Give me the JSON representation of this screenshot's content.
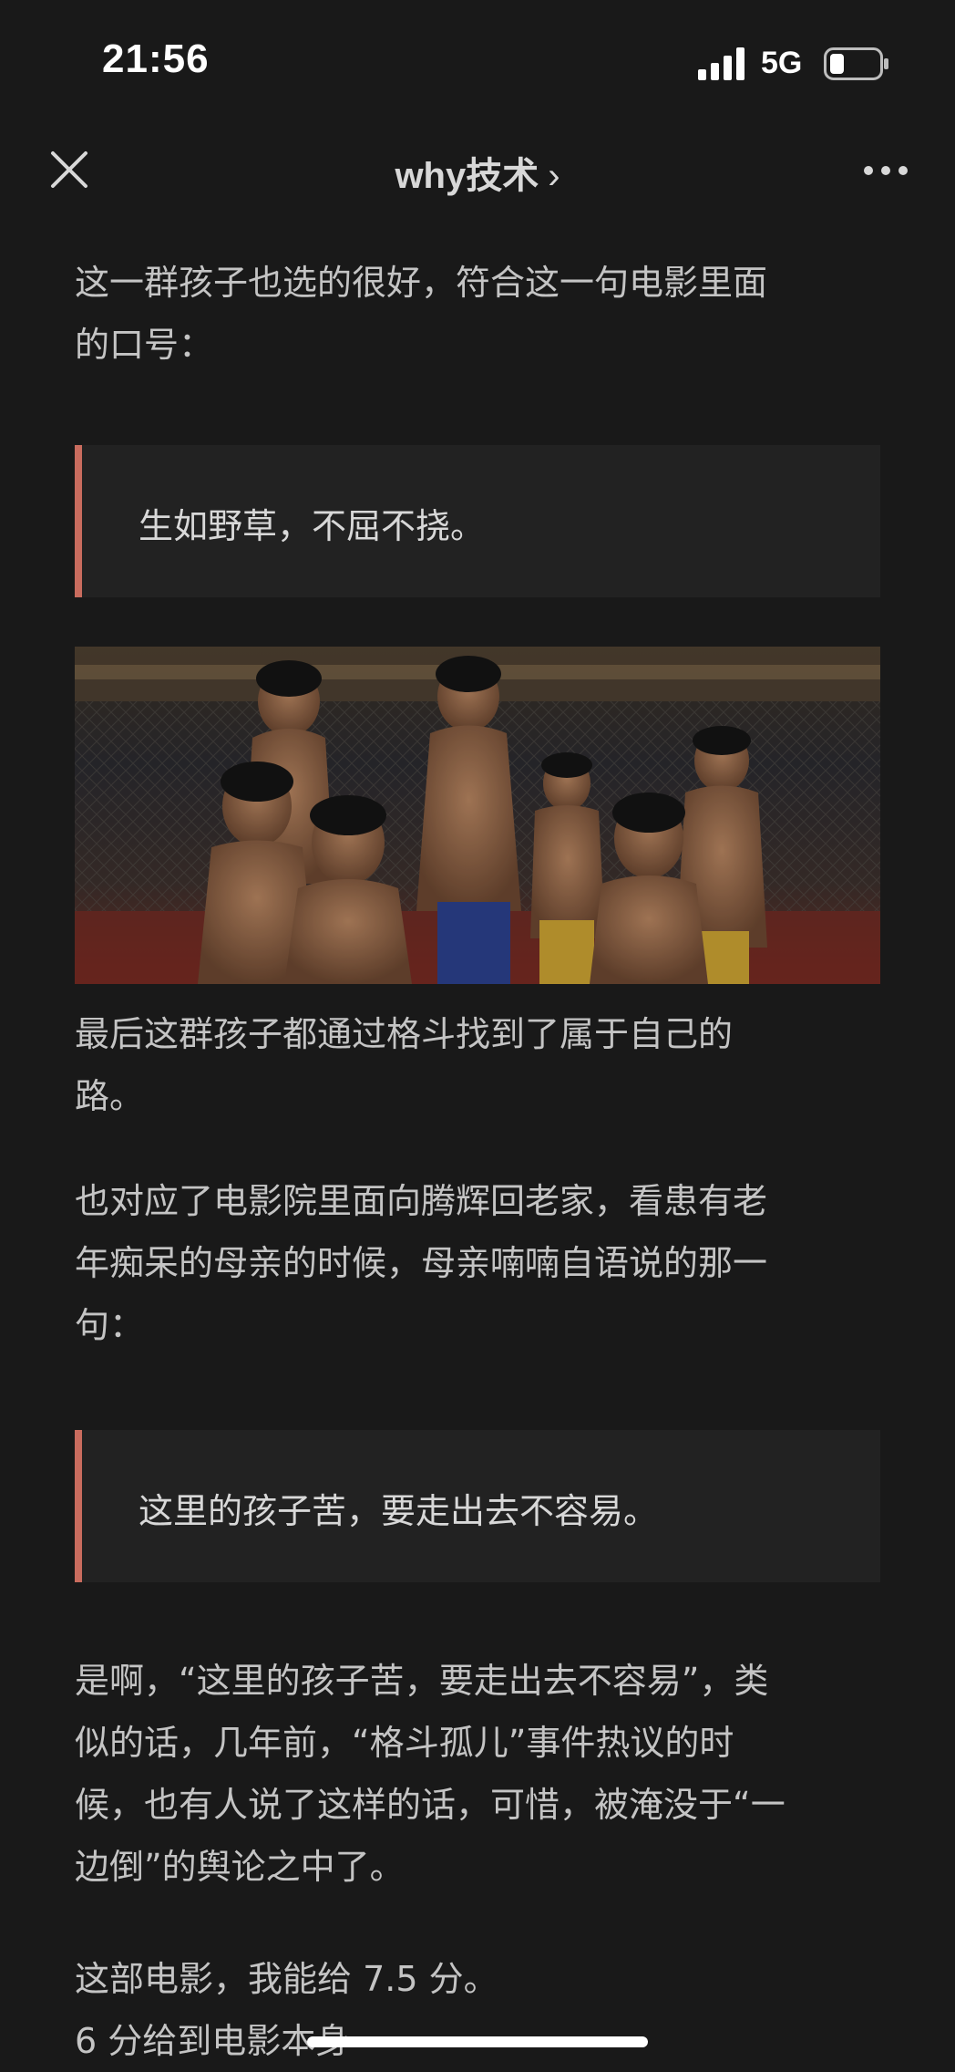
{
  "status_bar": {
    "time": "21:56",
    "network": "5G",
    "signal_icon": "signal-bars-icon",
    "battery_icon": "battery-low-icon"
  },
  "nav": {
    "title": "why技术",
    "chevron": "›",
    "close_icon": "close-icon",
    "more_icon": "more-icon"
  },
  "article": {
    "p1_line1": "这一群孩子也选的很好，符合这一句电影里面",
    "p1_line2": "的口号：",
    "quote1": "生如野草，不屈不挠。",
    "p2_line1": "最后这群孩子都通过格斗找到了属于自己的",
    "p2_line2": "路。",
    "p3_line1": "也对应了电影院里面向腾辉回老家，看患有老",
    "p3_line2": "年痴呆的母亲的时候，母亲喃喃自语说的那一",
    "p3_line3": "句：",
    "quote2": "这里的孩子苦，要走出去不容易。",
    "p4_line1": "是啊，“这里的孩子苦，要走出去不容易”，类",
    "p4_line2": "似的话，几年前，“格斗孤儿”事件热议的时",
    "p4_line3": "候，也有人说了这样的话，可惜，被淹没于“一",
    "p4_line4": "边倒”的舆论之中了。",
    "p5_line1": "这部电影，我能给 7.5 分。",
    "p6_partial": "6 分给到电影本身"
  },
  "colors": {
    "background": "#191919",
    "quote_bar": "#c96c5e",
    "quote_bg": "#222222"
  }
}
